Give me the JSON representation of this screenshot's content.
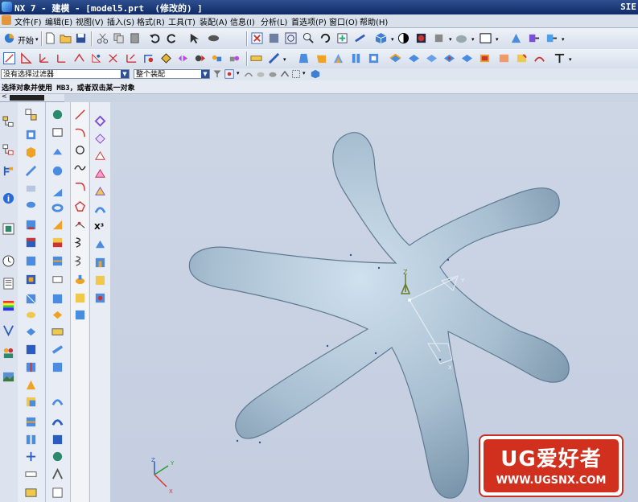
{
  "window": {
    "title": "NX 7 - 建模 - [model5.prt  (修改的) ]",
    "brand": "SIE"
  },
  "menu": [
    "文件(F)",
    "编辑(E)",
    "视图(V)",
    "插入(S)",
    "格式(R)",
    "工具(T)",
    "装配(A)",
    "信息(I)",
    "分析(L)",
    "首选项(P)",
    "窗口(O)",
    "帮助(H)"
  ],
  "toolbar": {
    "start_label": "开始"
  },
  "selection_bar": {
    "filter_value": "没有选择过滤器",
    "scope_value": "整个装配"
  },
  "cue_line": "选择对象并使用 MB3，或者双击某一对象",
  "viewport": {
    "model_color": "#9fb5c8",
    "background_color": "#c9d3e2",
    "triad_labels": {
      "x": "X",
      "y": "Y",
      "z": "Z"
    },
    "wcs_labels": {
      "x": "X",
      "y": "Y",
      "z": "Z"
    }
  },
  "watermark": {
    "main": "UG爱好者",
    "url": "WWW.UGSNX.COM",
    "color": "#d2301f"
  },
  "colors": {
    "title_bar": "#1c3b7d",
    "accent_blue": "#2d4f98"
  }
}
